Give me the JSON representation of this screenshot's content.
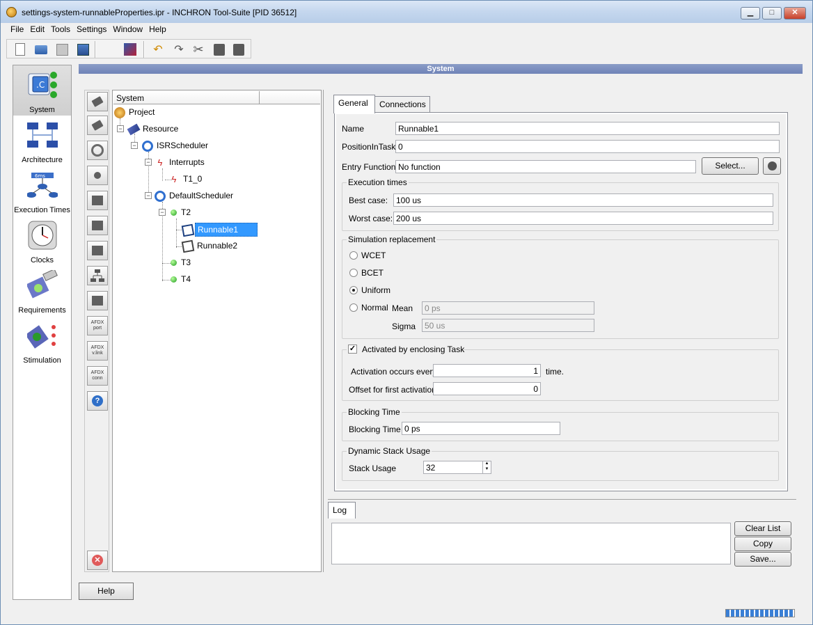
{
  "window": {
    "title": "settings-system-runnableProperties.ipr - INCHRON Tool-Suite [PID 36512]",
    "controls": {
      "minimize": "▁",
      "maximize": "□",
      "close": "✕"
    }
  },
  "menu": [
    "File",
    "Edit",
    "Tools",
    "Settings",
    "Window",
    "Help"
  ],
  "nav": {
    "items": [
      {
        "label": "System",
        "selected": true
      },
      {
        "label": "Architecture"
      },
      {
        "label": "Execution Times",
        "badge": "6ms"
      },
      {
        "label": "Clocks"
      },
      {
        "label": "Requirements"
      },
      {
        "label": "Stimulation"
      }
    ]
  },
  "section_title": "System",
  "vtool": {
    "afdx_port": "AFDX\nport",
    "afdx_vlink": "AFDX\nv.link",
    "afdx_conn": "AFDX\nconn",
    "help": "?",
    "delete": "✕"
  },
  "tree": {
    "header": "System",
    "nodes": {
      "project": "Project",
      "resource": "Resource",
      "isr": "ISRScheduler",
      "interrupts": "Interrupts",
      "t1_0": "T1_0",
      "default": "DefaultScheduler",
      "t2": "T2",
      "runnable1": "Runnable1",
      "runnable2": "Runnable2",
      "t3": "T3",
      "t4": "T4"
    }
  },
  "tabs": {
    "general": "General",
    "connections": "Connections"
  },
  "general": {
    "name_label": "Name",
    "name_value": "Runnable1",
    "position_label": "PositionInTask",
    "position_value": "0",
    "entry_label": "Entry Function",
    "entry_value": "No function",
    "select_button": "Select...",
    "exec": {
      "title": "Execution times",
      "best_label": "Best case:",
      "best_value": "100 us",
      "worst_label": "Worst case:",
      "worst_value": "200 us"
    },
    "sim": {
      "title": "Simulation replacement",
      "options": [
        "WCET",
        "BCET",
        "Uniform",
        "Normal"
      ],
      "selected": "Uniform",
      "mean_label": "Mean",
      "mean_value": "0 ps",
      "sigma_label": "Sigma",
      "sigma_value": "50 us"
    },
    "activation": {
      "check_label": "Activated by enclosing Task",
      "checked": true,
      "every_label": "Activation occurs every",
      "every_value": "1",
      "every_unit": "time.",
      "offset_label": "Offset for first activation:",
      "offset_value": "0"
    },
    "blocking": {
      "title": "Blocking Time",
      "label": "Blocking Time",
      "value": "0 ps"
    },
    "stack": {
      "title": "Dynamic Stack Usage",
      "label": "Stack Usage",
      "value": "32"
    }
  },
  "log": {
    "tab": "Log",
    "buttons": {
      "clear": "Clear List",
      "copy": "Copy",
      "save": "Save..."
    }
  },
  "help_button": "Help"
}
